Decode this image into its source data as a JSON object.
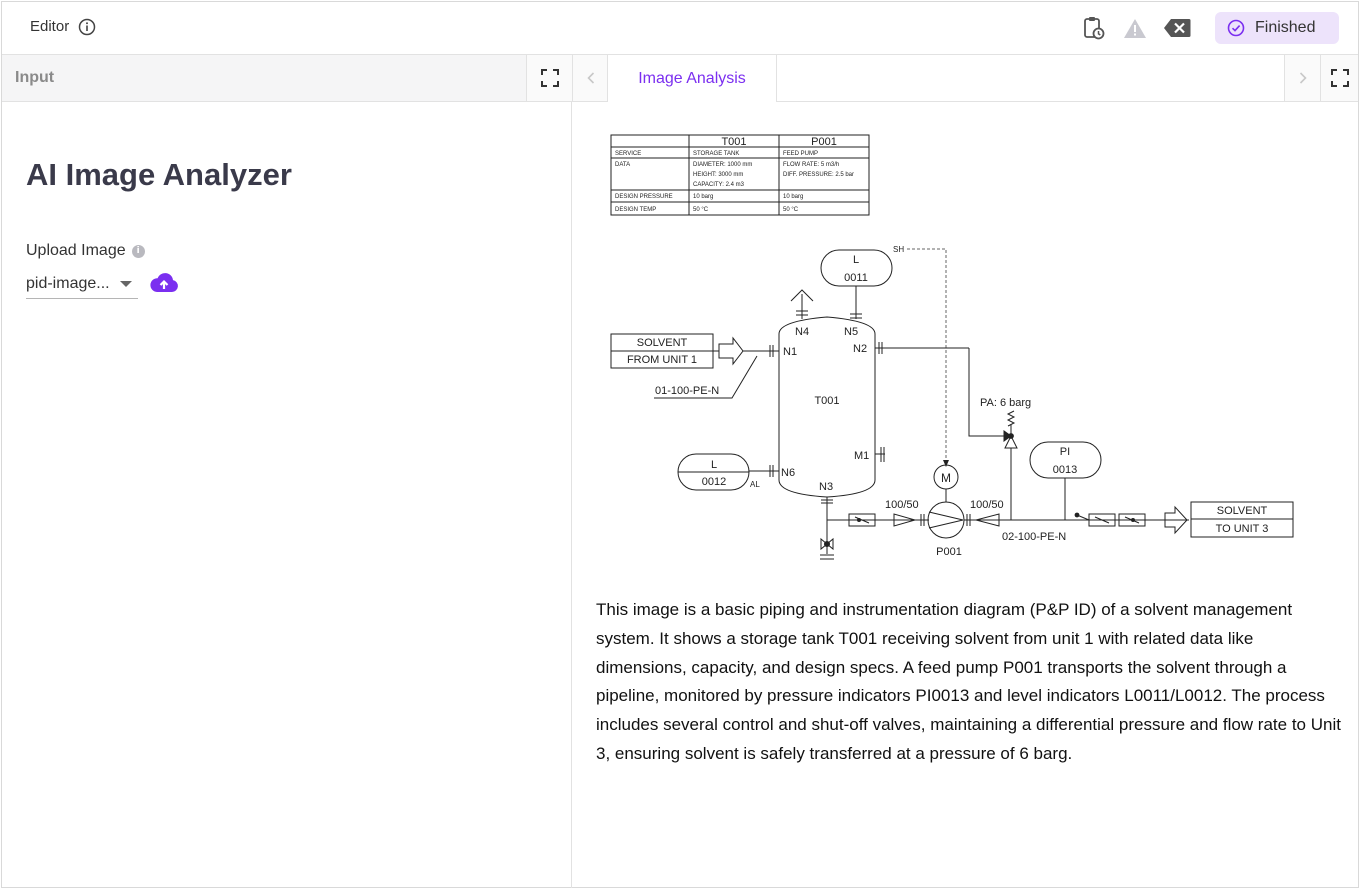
{
  "topbar": {
    "editor_label": "Editor",
    "finished_label": "Finished"
  },
  "tabs": {
    "input_label": "Input",
    "analysis_label": "Image Analysis"
  },
  "left": {
    "title": "AI Image Analyzer",
    "upload_label": "Upload Image",
    "file_value": "pid-image..."
  },
  "diagram": {
    "table": {
      "headers": [
        "T001",
        "P001"
      ],
      "rows": [
        {
          "label": "SERVICE",
          "t001": [
            "STORAGE TANK"
          ],
          "p001": [
            "FEED PUMP"
          ]
        },
        {
          "label": "DATA",
          "t001": [
            "DIAMETER: 1000 mm",
            "HEIGHT: 3000 mm",
            "CAPACITY: 2.4 m3"
          ],
          "p001": [
            "FLOW RATE: 5 m3/h",
            "DIFF. PRESSURE: 2.5 bar"
          ]
        },
        {
          "label": "DESIGN PRESSURE",
          "t001": [
            "10 barg"
          ],
          "p001": [
            "10 barg"
          ]
        },
        {
          "label": "DESIGN TEMP",
          "t001": [
            "50 °C"
          ],
          "p001": [
            "50 °C"
          ]
        }
      ]
    },
    "labels": {
      "solvent_in_1": "SOLVENT",
      "solvent_in_2": "FROM UNIT 1",
      "line_in": "01-100-PE-N",
      "tank": "T001",
      "n1": "N1",
      "n2": "N2",
      "n3": "N3",
      "n4": "N4",
      "n5": "N5",
      "n6": "N6",
      "m1": "M1",
      "l0011_top": "L",
      "l0011_bottom": "0011",
      "sh": "SH",
      "l0012_top": "L",
      "l0012_bottom": "0012",
      "al": "AL",
      "pa": "PA: 6 barg",
      "pi_top": "PI",
      "pi_bottom": "0013",
      "motor": "M",
      "red1": "100/50",
      "red2": "100/50",
      "pump": "P001",
      "line_out": "02-100-PE-N",
      "solvent_out_1": "SOLVENT",
      "solvent_out_2": "TO UNIT 3"
    }
  },
  "analysis": {
    "text": "This image is a basic piping and instrumentation diagram (P&P ID) of a solvent management system. It shows a storage tank T001 receiving solvent from unit 1 with related data like dimensions, capacity, and design specs. A feed pump P001 transports the solvent through a pipeline, monitored by pressure indicators PI0013 and level indicators L0011/L0012. The process includes several control and shut-off valves, maintaining a differential pressure and flow rate to Unit 3, ensuring solvent is safely transferred at a pressure of 6 barg."
  },
  "colors": {
    "accent": "#7b2ff0",
    "finished_bg": "#ede3fb"
  }
}
